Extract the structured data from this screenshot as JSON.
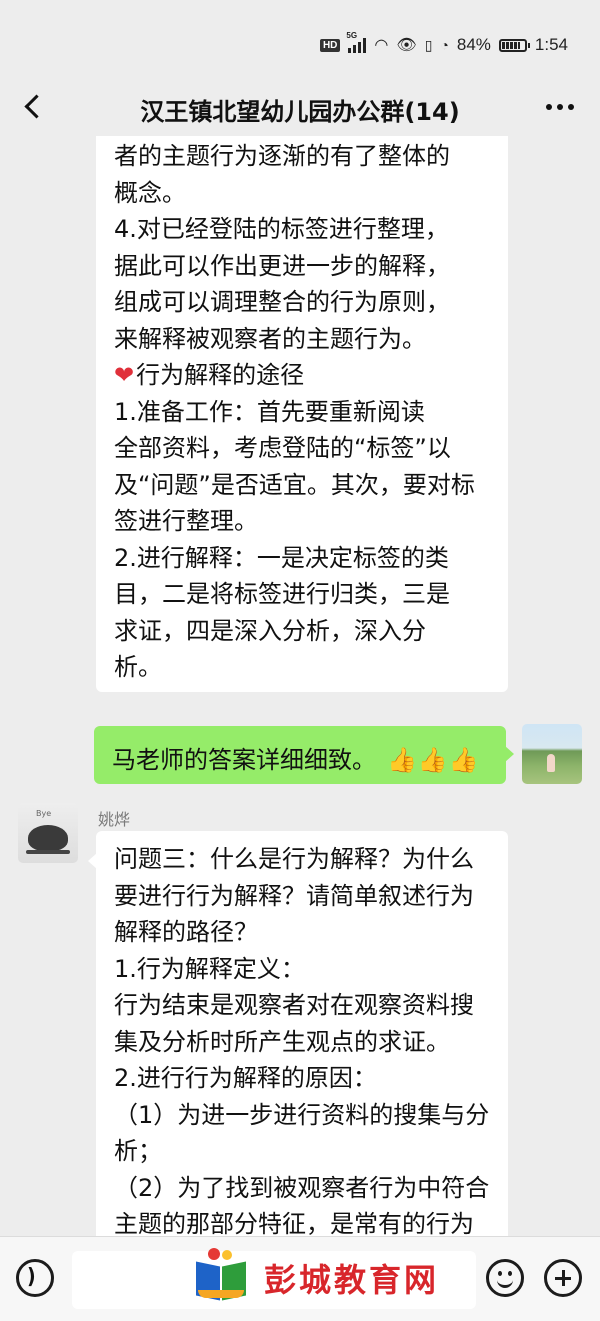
{
  "status_bar": {
    "hd": "HD",
    "network": "5G",
    "battery_percent": "84%",
    "time": "1:54",
    "battery_level": 0.84
  },
  "header": {
    "title": "汉王镇北望幼儿园办公群(14)",
    "back_icon": "chevron-left-icon",
    "more_icon": "more-horizontal-icon"
  },
  "messages": [
    {
      "side": "left",
      "lines": [
        "者的主题行为逐渐的有了整体的",
        "概念。",
        "4.对已经登陆的标签进行整理，",
        "据此可以作出更进一步的解释，",
        "组成可以调理整合的行为原则，",
        "来解释被观察者的主题行为。",
        "行为解释的途径",
        "1.准备工作：首先要重新阅读",
        "全部资料，考虑登陆的“标签”以",
        "及“问题”是否适宜。其次，要对标",
        "签进行整理。",
        "2.进行解释：一是决定标签的类",
        "目，二是将标签进行归类，三是",
        "求证，四是深入分析，深入分",
        "析。"
      ]
    },
    {
      "side": "right",
      "text": "马老师的答案详细细致。",
      "emoji": [
        "👍",
        "👍",
        "👍"
      ]
    },
    {
      "side": "left",
      "sender": "姚烨",
      "lines": [
        "问题三：什么是行为解释？为什么",
        "要进行行为解释？请简单叙述行为",
        "解释的路径？",
        "1.行为解释定义：",
        "行为结束是观察者对在观察资料搜",
        "集及分析时所产生观点的求证。",
        "2.进行行为解释的原因：",
        "（1）为进一步进行资料的搜集与分",
        "析；",
        "（2）为了找到被观察者行为中符合",
        "主题的那部分特征，是常有的行为"
      ]
    }
  ],
  "avatars": {
    "self": "photo-avatar",
    "yao_label": "Bye"
  },
  "input_bar": {
    "voice_icon": "voice-icon",
    "emoji_icon": "emoji-icon",
    "plus_icon": "plus-icon",
    "placeholder": ""
  },
  "watermark": {
    "text": "彭城教育网"
  },
  "colors": {
    "background": "#ededed",
    "self_bubble": "#95ec69",
    "other_bubble": "#ffffff",
    "heart": "#e0303a",
    "watermark_text": "#d8262b"
  }
}
